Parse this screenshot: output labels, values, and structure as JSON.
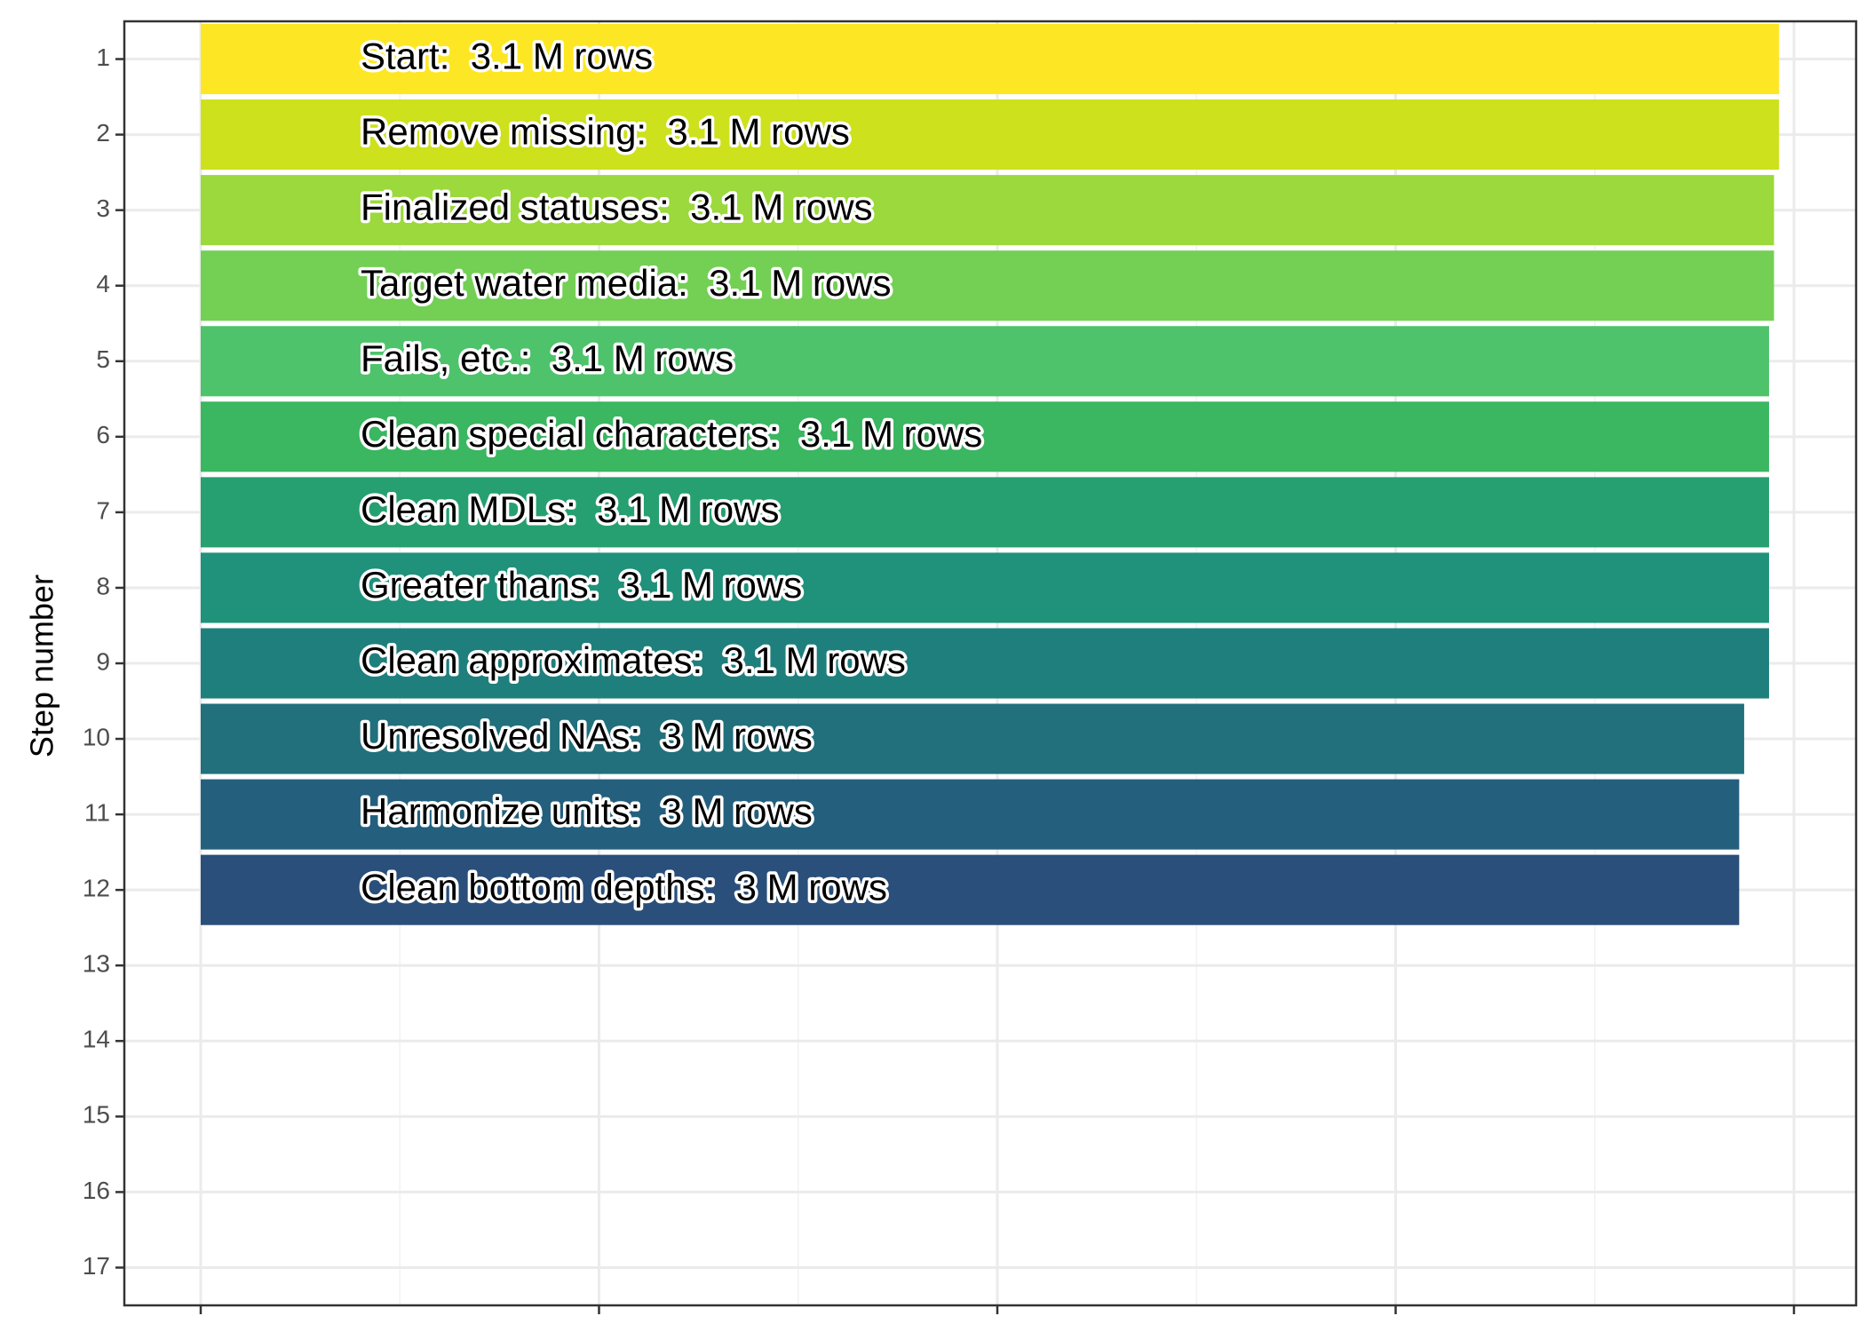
{
  "chart_data": {
    "type": "bar",
    "orientation": "horizontal",
    "title": "",
    "xlabel": "",
    "ylabel": "Step number",
    "ylim": [
      0.5,
      17.5
    ],
    "yticks": [
      1,
      2,
      3,
      4,
      5,
      6,
      7,
      8,
      9,
      10,
      11,
      12,
      13,
      14,
      15,
      16,
      17
    ],
    "xlim": [
      0,
      3.15
    ],
    "xticks": [
      0,
      0.8,
      1.6,
      2.4,
      3.2
    ],
    "grid": true,
    "legend": "none",
    "bars": [
      {
        "step": 1,
        "label": "Start:  3.1 M rows",
        "value": 3.17,
        "color": "#FDE725"
      },
      {
        "step": 2,
        "label": "Remove missing:  3.1 M rows",
        "value": 3.17,
        "color": "#CDE11D"
      },
      {
        "step": 3,
        "label": "Finalized statuses:  3.1 M rows",
        "value": 3.16,
        "color": "#9BD93C"
      },
      {
        "step": 4,
        "label": "Target water media:  3.1 M rows",
        "value": 3.16,
        "color": "#73D055"
      },
      {
        "step": 5,
        "label": "Fails, etc.:  3.1 M rows",
        "value": 3.15,
        "color": "#4EC36B"
      },
      {
        "step": 6,
        "label": "Clean special characters:  3.1 M rows",
        "value": 3.15,
        "color": "#3BB661"
      },
      {
        "step": 7,
        "label": "Clean MDLs:  3.1 M rows",
        "value": 3.15,
        "color": "#26A070"
      },
      {
        "step": 8,
        "label": "Greater thans:  3.1 M rows",
        "value": 3.15,
        "color": "#20917A"
      },
      {
        "step": 9,
        "label": "Clean approximates:  3.1 M rows",
        "value": 3.15,
        "color": "#1F7F7D"
      },
      {
        "step": 10,
        "label": "Unresolved NAs:  3 M rows",
        "value": 3.1,
        "color": "#21707C"
      },
      {
        "step": 11,
        "label": "Harmonize units:  3 M rows",
        "value": 3.09,
        "color": "#24607E"
      },
      {
        "step": 12,
        "label": "Clean bottom depths:  3 M rows",
        "value": 3.09,
        "color": "#2A4F7A"
      }
    ]
  }
}
